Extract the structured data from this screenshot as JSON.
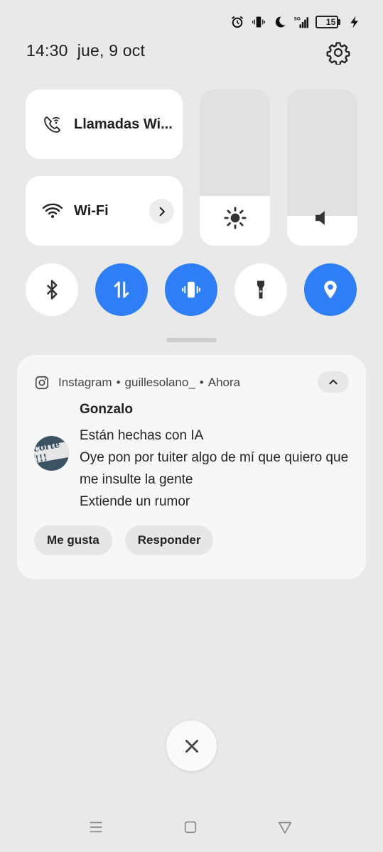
{
  "status_bar": {
    "battery_level": "15",
    "network": "5G",
    "icons": [
      "alarm-icon",
      "vibrate-icon",
      "moon-icon",
      "signal-5g-icon",
      "battery-icon",
      "charging-icon"
    ]
  },
  "header": {
    "time": "14:30",
    "date": "jue, 9 oct"
  },
  "quick_settings": {
    "tiles": [
      {
        "label": "Llamadas Wi...",
        "icon": "wifi-calling-icon"
      },
      {
        "label": "Wi-Fi",
        "icon": "wifi-icon"
      }
    ],
    "brightness_level": 0.32,
    "volume_level": 0.19,
    "toggles": [
      {
        "name": "bluetooth",
        "icon": "bluetooth-icon",
        "active": false
      },
      {
        "name": "mobile-data",
        "icon": "data-arrows-icon",
        "active": true
      },
      {
        "name": "vibrate",
        "icon": "vibrate-icon",
        "active": true
      },
      {
        "name": "flashlight",
        "icon": "flashlight-icon",
        "active": false
      },
      {
        "name": "location",
        "icon": "location-pin-icon",
        "active": true
      }
    ],
    "active_color": "#2d7ef7"
  },
  "notification": {
    "app": "Instagram",
    "account": "guillesolano_",
    "time": "Ahora",
    "separator": "•",
    "sender": "Gonzalo",
    "avatar_text": "corte !!!",
    "messages": [
      "Están hechas con IA",
      "Oye pon por tuiter algo de mí que quiero que me insulte la gente",
      "Extiende un rumor"
    ],
    "actions": [
      "Me gusta",
      "Responder"
    ]
  }
}
